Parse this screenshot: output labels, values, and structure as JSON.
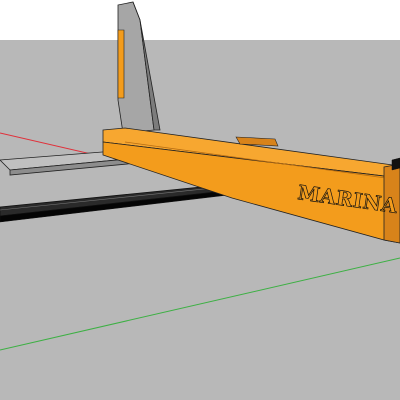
{
  "viewport": {
    "sky_color": "#ffffff",
    "ground_color": "#b8b8b8"
  },
  "model": {
    "beam_label": "MARINA",
    "beam_color": "#f39c1c",
    "beam_shadow_color": "#d8831a",
    "mast_color": "#9b9b9b",
    "mast_highlight_color": "#c9c9c9",
    "plate_color": "#a9a9a9",
    "blade_color": "#1a1a1a"
  },
  "axes": {
    "red_axis_color": "#e0303a",
    "green_axis_color": "#3cb043"
  }
}
